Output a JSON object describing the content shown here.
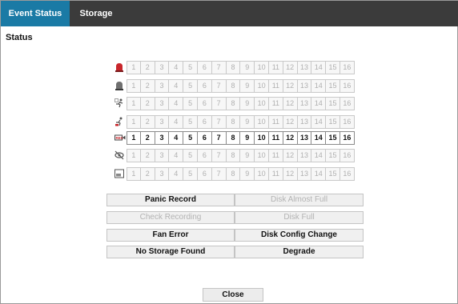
{
  "tabs": [
    {
      "label": "Event Status",
      "active": true
    },
    {
      "label": "Storage",
      "active": false
    }
  ],
  "section_title": "Status",
  "channels": [
    "1",
    "2",
    "3",
    "4",
    "5",
    "6",
    "7",
    "8",
    "9",
    "10",
    "11",
    "12",
    "13",
    "14",
    "15",
    "16"
  ],
  "rows": [
    {
      "icon": "alarm-in-icon",
      "active": false
    },
    {
      "icon": "alarm-out-icon",
      "active": false
    },
    {
      "icon": "motion-icon",
      "active": false
    },
    {
      "icon": "trip-zone-icon",
      "active": false
    },
    {
      "icon": "recording-icon",
      "active": true
    },
    {
      "icon": "video-loss-icon",
      "active": false
    },
    {
      "icon": "tamper-icon",
      "active": false
    }
  ],
  "status_buttons": [
    {
      "label": "Panic Record",
      "active": true
    },
    {
      "label": "Disk Almost Full",
      "active": false
    },
    {
      "label": "Check Recording",
      "active": false
    },
    {
      "label": "Disk Full",
      "active": false
    },
    {
      "label": "Fan Error",
      "active": true
    },
    {
      "label": "Disk Config Change",
      "active": true
    },
    {
      "label": "No Storage Found",
      "active": true
    },
    {
      "label": "Degrade",
      "active": true
    }
  ],
  "close_label": "Close",
  "colors": {
    "tab_active": "#1a7aa5",
    "tabbar": "#3b3b3b",
    "alarm_red": "#c8262b"
  }
}
